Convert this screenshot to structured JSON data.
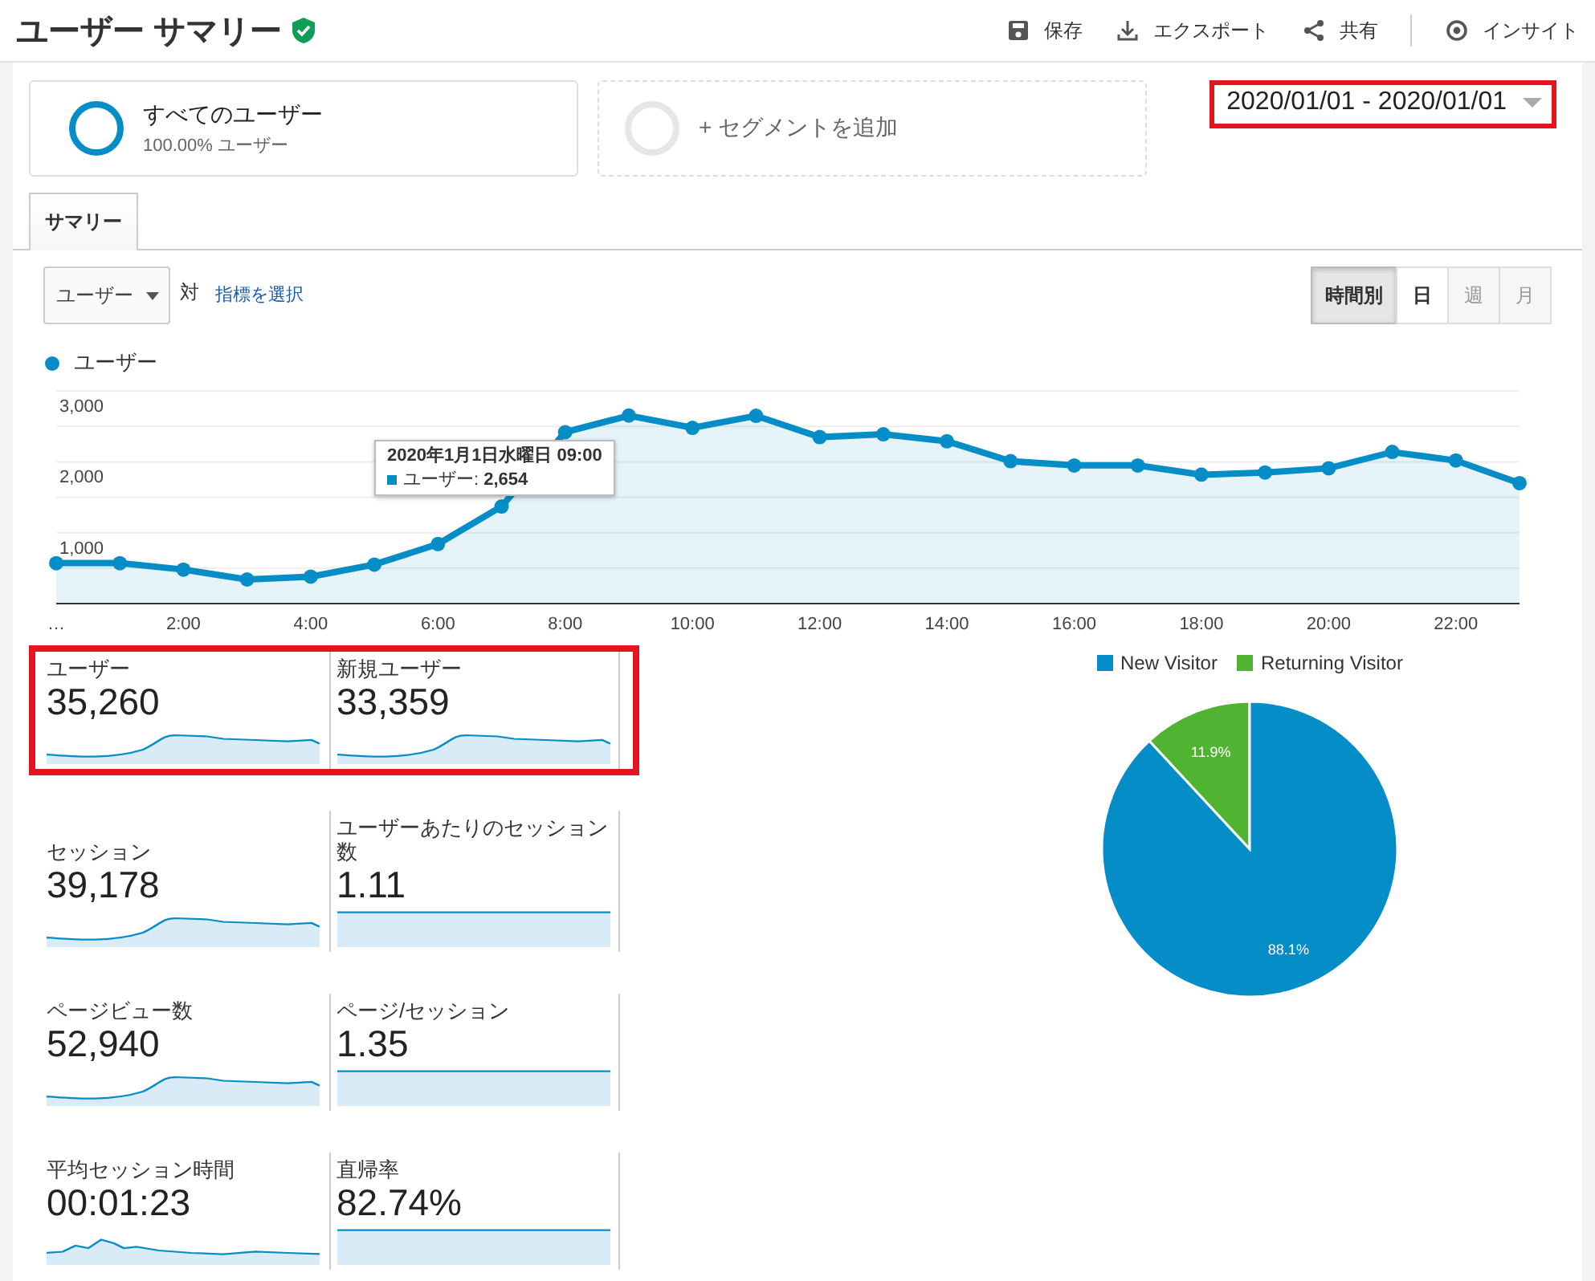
{
  "header": {
    "title": "ユーザー サマリー",
    "actions": [
      {
        "kind": "save",
        "label": "保存"
      },
      {
        "kind": "export",
        "label": "エクスポート"
      },
      {
        "kind": "share",
        "label": "共有"
      },
      {
        "kind": "insight",
        "label": "インサイト"
      }
    ]
  },
  "segments": [
    {
      "kind": "active",
      "title": "すべてのユーザー",
      "subtitle": "100.00% ユーザー"
    },
    {
      "kind": "add",
      "title": "+ セグメントを追加"
    }
  ],
  "date_range": {
    "label": "2020/01/01 - 2020/01/01",
    "highlighted": true
  },
  "tabs": [
    {
      "label": "サマリー",
      "selected": true
    }
  ],
  "metric_dropdown": {
    "value": "ユーザー"
  },
  "versus_label": "対",
  "select_metric_link": "指標を選択",
  "granularity": [
    {
      "label": "時間別",
      "selected": true,
      "disabled": false
    },
    {
      "label": "日",
      "selected": false,
      "disabled": false
    },
    {
      "label": "週",
      "selected": false,
      "disabled": true
    },
    {
      "label": "月",
      "selected": false,
      "disabled": true
    }
  ],
  "chart_data": {
    "type": "area",
    "x": [
      0,
      1,
      2,
      3,
      4,
      5,
      6,
      7,
      8,
      9,
      10,
      11,
      12,
      13,
      14,
      15,
      16,
      17,
      18,
      19,
      20,
      21,
      22,
      23
    ],
    "xlim": [
      0,
      23
    ],
    "series": [
      {
        "name": "ユーザー",
        "color": "#058dc7",
        "values": [
          570,
          570,
          480,
          340,
          380,
          550,
          840,
          1370,
          2420,
          2654,
          2480,
          2650,
          2350,
          2390,
          2290,
          2010,
          1950,
          1950,
          1820,
          1850,
          1910,
          2140,
          2020,
          1700
        ]
      }
    ],
    "ylim": [
      0,
      3000
    ],
    "yticks": [
      {
        "value": 1000,
        "label": "1,000"
      },
      {
        "value": 2000,
        "label": "2,000"
      },
      {
        "value": 3000,
        "label": "3,000"
      }
    ],
    "xticks": [
      {
        "value": 0,
        "label": "…"
      },
      {
        "value": 2,
        "label": "2:00"
      },
      {
        "value": 4,
        "label": "4:00"
      },
      {
        "value": 6,
        "label": "6:00"
      },
      {
        "value": 8,
        "label": "8:00"
      },
      {
        "value": 10,
        "label": "10:00"
      },
      {
        "value": 12,
        "label": "12:00"
      },
      {
        "value": 14,
        "label": "14:00"
      },
      {
        "value": 16,
        "label": "16:00"
      },
      {
        "value": 18,
        "label": "18:00"
      },
      {
        "value": 20,
        "label": "20:00"
      },
      {
        "value": 22,
        "label": "22:00"
      }
    ]
  },
  "tooltip": {
    "title": "2020年1月1日水曜日 09:00",
    "label": "ユーザー: ",
    "value": "2,654"
  },
  "metric_rows": [
    {
      "highlighted": true,
      "metrics": [
        {
          "label": "ユーザー",
          "value": "35,260",
          "kind": "curve"
        },
        {
          "label": "新規ユーザー",
          "value": "33,359",
          "kind": "curve"
        }
      ]
    },
    {
      "highlighted": false,
      "metrics": [
        {
          "label": "セッション",
          "value": "39,178",
          "kind": "curve"
        },
        {
          "label": "ユーザーあたりのセッション数",
          "value": "1.11",
          "kind": "flat"
        }
      ]
    },
    {
      "highlighted": false,
      "metrics": [
        {
          "label": "ページビュー数",
          "value": "52,940",
          "kind": "curve"
        },
        {
          "label": "ページ/セッション",
          "value": "1.35",
          "kind": "flat"
        }
      ]
    },
    {
      "highlighted": false,
      "metrics": [
        {
          "label": "平均セッション時間",
          "value": "00:01:23",
          "kind": "spiky"
        },
        {
          "label": "直帰率",
          "value": "82.74%",
          "kind": "flat"
        }
      ]
    }
  ],
  "pie": {
    "chart_data": {
      "type": "pie",
      "categories": [
        "New Visitor",
        "Returning Visitor"
      ],
      "values": [
        88.1,
        11.9
      ],
      "colors": [
        "#058dc7",
        "#50b432"
      ],
      "value_labels": [
        "88.1%",
        "11.9%"
      ],
      "legend": true
    }
  }
}
